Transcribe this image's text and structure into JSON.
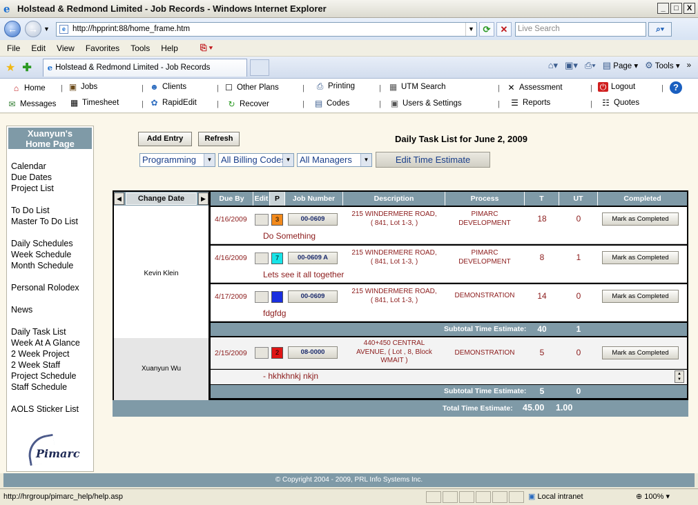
{
  "window": {
    "title": "Holstead & Redmond Limited - Job Records - Windows Internet Explorer",
    "min_btn": "_",
    "max_btn": "□",
    "close_btn": "X"
  },
  "addressbar": {
    "url": "http://hpprint:88/home_frame.htm",
    "search_placeholder": "Live Search"
  },
  "menu": [
    "File",
    "Edit",
    "View",
    "Favorites",
    "Tools",
    "Help"
  ],
  "tab": {
    "title": "Holstead & Redmond Limited - Job Records"
  },
  "commandbar": {
    "page": "Page",
    "tools": "Tools"
  },
  "appnav": {
    "row1": [
      "Home",
      "Jobs",
      "Clients",
      "Other Plans",
      "Printing",
      "UTM Search",
      "Assessment",
      "Logout"
    ],
    "row2": [
      "Messages",
      "Timesheet",
      "RapidEdit",
      "Recover",
      "Codes",
      "Users & Settings",
      "Reports",
      "Quotes"
    ]
  },
  "sidebar": {
    "home_title_line1": "Xuanyun's",
    "home_title_line2": "Home Page",
    "links": [
      "Calendar",
      "Due Dates",
      "Project List",
      "To Do List",
      "Master To Do List",
      "Daily Schedules",
      "Week Schedule",
      "Month Schedule",
      "Personal Rolodex",
      "News",
      "Daily Task List",
      "Week At A Glance",
      "2 Week Project",
      "2 Week Staff",
      "Project Schedule",
      "Staff Schedule",
      "AOLS Sticker List"
    ],
    "logo_text": "Pimarc"
  },
  "toolbar": {
    "add_entry": "Add Entry",
    "refresh": "Refresh",
    "heading": "Daily Task List for June 2, 2009",
    "filter_process": "Programming",
    "filter_billing": "All Billing Codes",
    "filter_managers": "All Managers",
    "edit_time_estimate": "Edit Time Estimate"
  },
  "table": {
    "change_date": "Change Date",
    "headers": [
      "Due By",
      "Edit",
      "P",
      "Job Number",
      "Description",
      "Process",
      "T",
      "UT",
      "Completed"
    ],
    "mark_label": "Mark as Completed",
    "subtotal_label": "Subtotal Time Estimate:",
    "total_label": "Total Time Estimate:",
    "total_t": "45.00",
    "total_ut": "1.00",
    "groups": [
      {
        "person": "Kevin Klein",
        "subtotal_t": "40",
        "subtotal_ut": "1",
        "rows": [
          {
            "due": "4/16/2009",
            "p": "3",
            "p_color": "#f28a1c",
            "job": "00-0609",
            "desc1": "215 WINDERMERE ROAD,",
            "desc2": "( 841, Lot 1-3, )",
            "proc1": "PIMARC",
            "proc2": "DEVELOPMENT",
            "t": "18",
            "ut": "0",
            "note": "Do Something"
          },
          {
            "due": "4/16/2009",
            "p": "7",
            "p_color": "#18e4e8",
            "job": "00-0609 A",
            "desc1": "215 WINDERMERE ROAD,",
            "desc2": "( 841, Lot 1-3, )",
            "proc1": "PIMARC",
            "proc2": "DEVELOPMENT",
            "t": "8",
            "ut": "1",
            "note": "Lets see it all together"
          },
          {
            "due": "4/17/2009",
            "p": "",
            "p_color": "#1a2fe0",
            "job": "00-0609",
            "desc1": "215 WINDERMERE ROAD,",
            "desc2": "( 841, Lot 1-3, )",
            "proc1": "DEMONSTRATION",
            "proc2": "",
            "t": "14",
            "ut": "0",
            "note": "fdgfdg"
          }
        ]
      },
      {
        "person": "Xuanyun Wu",
        "subtotal_t": "5",
        "subtotal_ut": "0",
        "rows": [
          {
            "due": "2/15/2009",
            "p": "2",
            "p_color": "#e01515",
            "job": "08-0000",
            "desc1": "440+450 CENTRAL",
            "desc2": "AVENUE, ( Lot , 8, Block",
            "desc3": "WMAIT )",
            "proc1": "DEMONSTRATION",
            "proc2": "",
            "t": "5",
            "ut": "0",
            "note": "- hkhkhnkj nkjn"
          }
        ]
      }
    ]
  },
  "footer": {
    "copyright": "© Copyright 2004 - 2009, PRL Info Systems Inc."
  },
  "statusbar": {
    "url": "http://hrgroup/pimarc_help/help.asp",
    "zone": "Local intranet",
    "zoom": "100%"
  }
}
